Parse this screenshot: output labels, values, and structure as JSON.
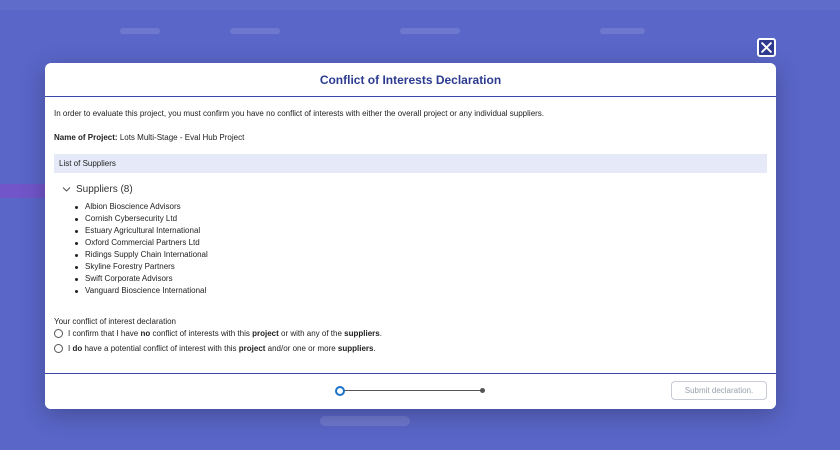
{
  "modal": {
    "title": "Conflict of Interests Declaration",
    "intro": "In order to evaluate this project, you must confirm you have no conflict of interests with either the overall project or any individual suppliers.",
    "project_label": "Name of Project:",
    "project_name": "Lots Multi-Stage - Eval Hub Project",
    "section_title": "List of Suppliers",
    "suppliers_toggle": "Suppliers (8)",
    "suppliers": [
      "Albion Bioscience Advisors",
      "Cornish Cybersecurity Ltd",
      "Estuary Agricultural International",
      "Oxford Commercial Partners Ltd",
      "Ridings Supply Chain International",
      "Skyline Forestry Partners",
      "Swift Corporate Advisors",
      "Vanguard Bioscience International"
    ],
    "declaration_label": "Your conflict of interest declaration",
    "option_no": {
      "t1": "I confirm that I have ",
      "b1": "no",
      "t2": " conflict of interests with this ",
      "b2": "project",
      "t3": " or with any of the ",
      "b3": "suppliers",
      "t4": "."
    },
    "option_yes": {
      "t1": "I ",
      "b1": "do",
      "t2": " have a potential conflict of interest with this ",
      "b2": "project",
      "t3": " and/or one or more ",
      "b3": "suppliers",
      "t4": "."
    },
    "submit_label": "Submit declaration.",
    "stepper": {
      "current_step": 1,
      "total_steps": 2
    }
  },
  "colors": {
    "backdrop": "#5a66c8",
    "title": "#2b3b8f",
    "accent": "#1a73c9",
    "section_bg": "#e6e9f7"
  },
  "icons": {
    "close": "close-icon",
    "chevron": "chevron-down-icon"
  }
}
